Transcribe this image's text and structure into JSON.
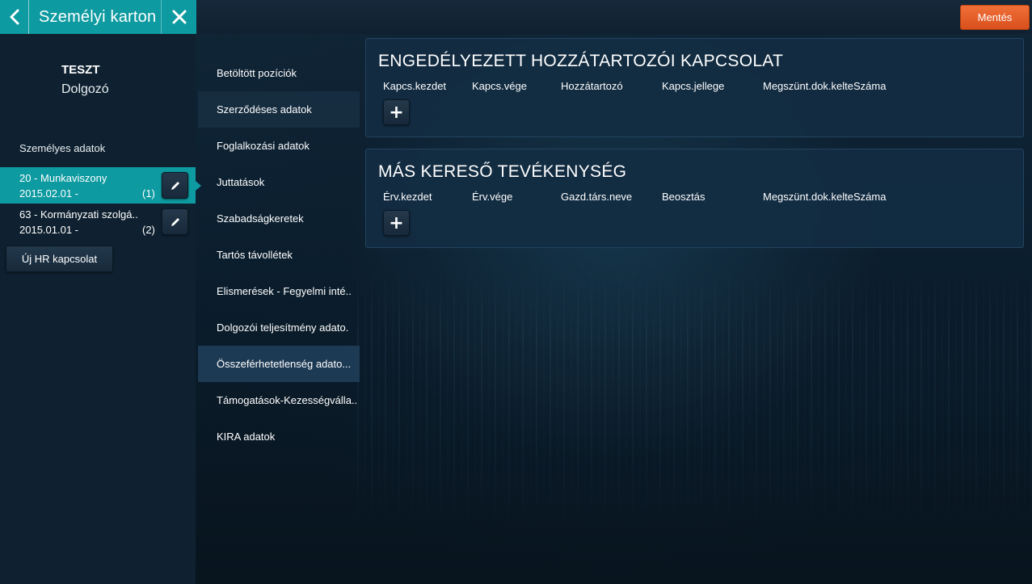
{
  "header": {
    "title": "Személyi karton",
    "save_label": "Mentés"
  },
  "employee": {
    "name": "TESZT",
    "role": "Dolgozó"
  },
  "left": {
    "section_label": "Személyes adatok",
    "hr_items": [
      {
        "line1": "20 - Munkaviszony",
        "line2": "2015.02.01 -",
        "count": "(1)",
        "active": true
      },
      {
        "line1": "63 - Kormányzati szolgá..",
        "line2": "2015.01.01 -",
        "count": "(2)",
        "active": false
      }
    ],
    "new_hr_label": "Új HR kapcsolat"
  },
  "nav": {
    "items": [
      "Betöltött pozíciók",
      "Szerződéses adatok",
      "Foglalkozási adatok",
      "Juttatások",
      "Szabadságkeretek",
      "Tartós távollétek",
      "Elismerések - Fegyelmi inté..",
      "Dolgozói teljesítmény adato.",
      "Összeférhetetlenség adato...",
      "Támogatások-Kezességválla..",
      "KIRA adatok"
    ],
    "active_index": 8
  },
  "cards": [
    {
      "title": "ENGEDÉLYEZETT HOZZÁTARTOZÓI KAPCSOLAT",
      "columns": [
        "Kapcs.kezdet",
        "Kapcs.vége",
        "Hozzátartozó",
        "Kapcs.jellege",
        "Megszünt.dok.kelteSzáma"
      ],
      "add_label": "+"
    },
    {
      "title": "MÁS KERESŐ TEVÉKENYSÉG",
      "columns": [
        "Érv.kezdet",
        "Érv.vége",
        "Gazd.társ.neve",
        "Beosztás",
        "Megszünt.dok.kelteSzáma"
      ],
      "add_label": "+"
    }
  ],
  "icons": {
    "back": "chevron-left-icon",
    "close": "close-icon",
    "edit": "pencil-icon"
  },
  "colors": {
    "accent": "#0d9aa0",
    "save": "#e85f28",
    "nav_active": "#1d3a54"
  }
}
